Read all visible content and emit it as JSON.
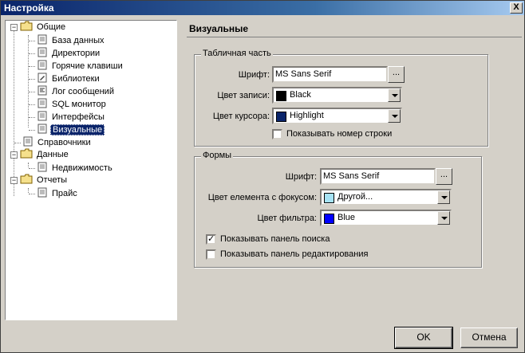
{
  "window": {
    "title": "Настройка",
    "close_label": "X"
  },
  "tree": {
    "root_general": "Общие",
    "general_children": [
      "База данных",
      "Директории",
      "Горячие клавиши",
      "Библиотеки",
      "Лог сообщений",
      "SQL монитор",
      "Интерфейсы",
      "Визуальные"
    ],
    "reference": "Справочники",
    "data": "Данные",
    "data_children": [
      "Недвижимость"
    ],
    "reports": "Отчеты",
    "reports_children": [
      "Прайс"
    ],
    "selected": "Визуальные"
  },
  "panel": {
    "title": "Визуальные",
    "table_group": {
      "legend": "Табличная часть",
      "font_label": "Шрифт:",
      "font_value": "MS Sans Serif",
      "ellipsis": "...",
      "record_color_label": "Цвет записи:",
      "record_color_value": "Black",
      "record_color_hex": "#000000",
      "cursor_color_label": "Цвет курсора:",
      "cursor_color_value": "Highlight",
      "cursor_color_hex": "#0a246a",
      "show_row_number_label": "Показывать номер строки",
      "show_row_number_checked": false
    },
    "forms_group": {
      "legend": "Формы",
      "font_label": "Шрифт:",
      "font_value": "MS Sans Serif",
      "ellipsis": "...",
      "focus_color_label": "Цвет елемента с фокусом:",
      "focus_color_value": "Другой...",
      "focus_color_hex": "#a6e3f5",
      "filter_color_label": "Цвет фильтра:",
      "filter_color_value": "Blue",
      "filter_color_hex": "#0000ff",
      "show_search_panel_label": "Показывать панель поиска",
      "show_search_panel_checked": true,
      "show_edit_panel_label": "Показывать панель редактирования",
      "show_edit_panel_checked": false
    }
  },
  "buttons": {
    "ok": "OK",
    "cancel": "Отмена"
  }
}
